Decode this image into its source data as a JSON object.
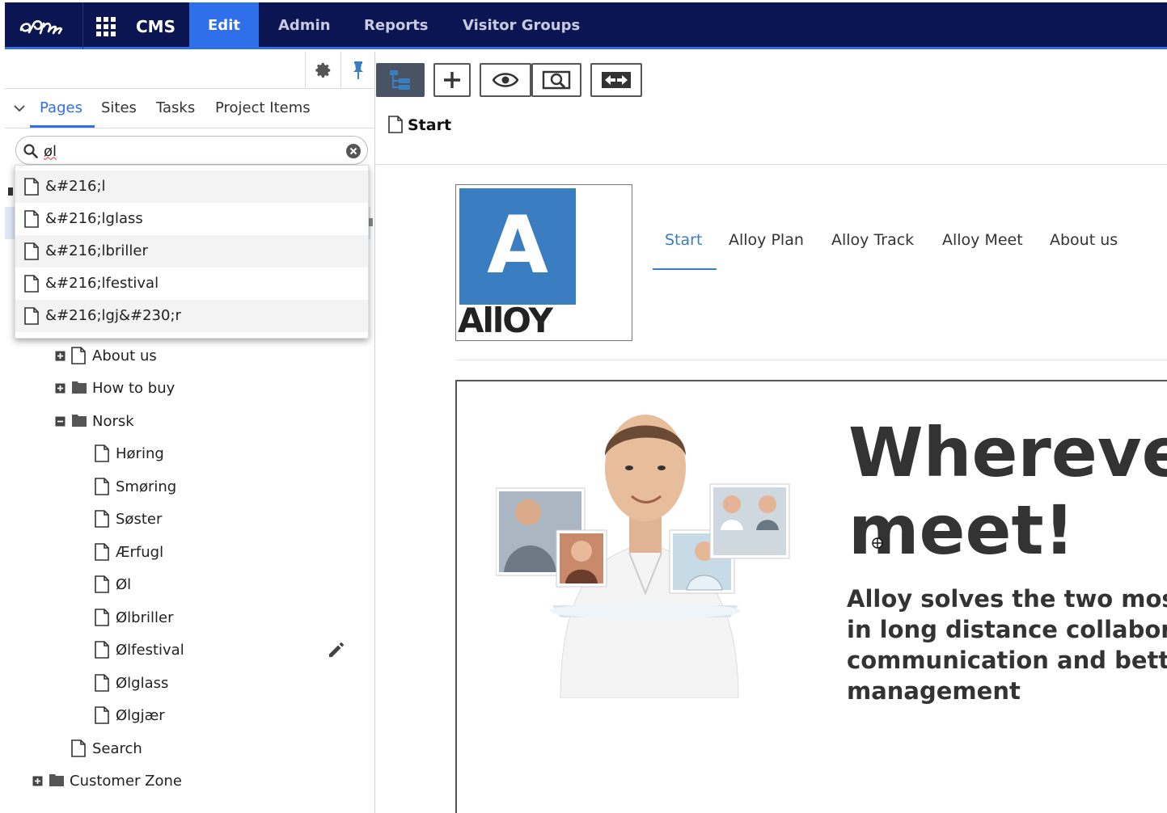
{
  "topbar": {
    "brand": "CMS",
    "nav": {
      "edit": "Edit",
      "admin": "Admin",
      "reports": "Reports",
      "visitor_groups": "Visitor Groups"
    },
    "colors": {
      "bar": "#0b1552",
      "active": "#2f6fea"
    }
  },
  "left_panel": {
    "tabs": {
      "pages": "Pages",
      "sites": "Sites",
      "tasks": "Tasks",
      "project_items": "Project Items"
    },
    "search": {
      "value": "øl"
    },
    "suggestions": [
      "&#216;l",
      "&#216;lglass",
      "&#216;lbriller",
      "&#216;lfestival",
      "&#216;lgj&#230;r"
    ],
    "tree": {
      "about_us": "About us",
      "how_to_buy": "How to buy",
      "norsk": "Norsk",
      "norsk_children": [
        "Høring",
        "Smøring",
        "Søster",
        "Ærfugl",
        "Øl",
        "Ølbriller",
        "Ølfestival",
        "Ølglass",
        "Ølgjær"
      ],
      "search": "Search",
      "customer_zone": "Customer Zone"
    },
    "icons": [
      "gear-icon",
      "pin-icon",
      "chevron-down-icon",
      "search-icon",
      "clear-icon",
      "page-icon",
      "folder-icon",
      "expand-icon",
      "collapse-icon",
      "pencil-icon"
    ]
  },
  "right_panel": {
    "page_title": "Start",
    "toolbar_icons": [
      "page-tree-icon",
      "add-icon",
      "view-icon",
      "preview-icon",
      "compare-icon"
    ],
    "site": {
      "logo_text": "AllOY",
      "logo_letter": "A",
      "nav": {
        "start": "Start",
        "plan": "Alloy Plan",
        "track": "Alloy Track",
        "meet": "Alloy Meet",
        "about": "About us"
      },
      "hero_title_1": "Wherever",
      "hero_title_2": "meet!",
      "hero_sub_1": "Alloy solves the two most",
      "hero_sub_2": "in long distance collaboration",
      "hero_sub_3": "communication and better",
      "hero_sub_4": "management",
      "colors": {
        "brand_blue": "#3b7dc1",
        "text": "#333333"
      }
    }
  }
}
